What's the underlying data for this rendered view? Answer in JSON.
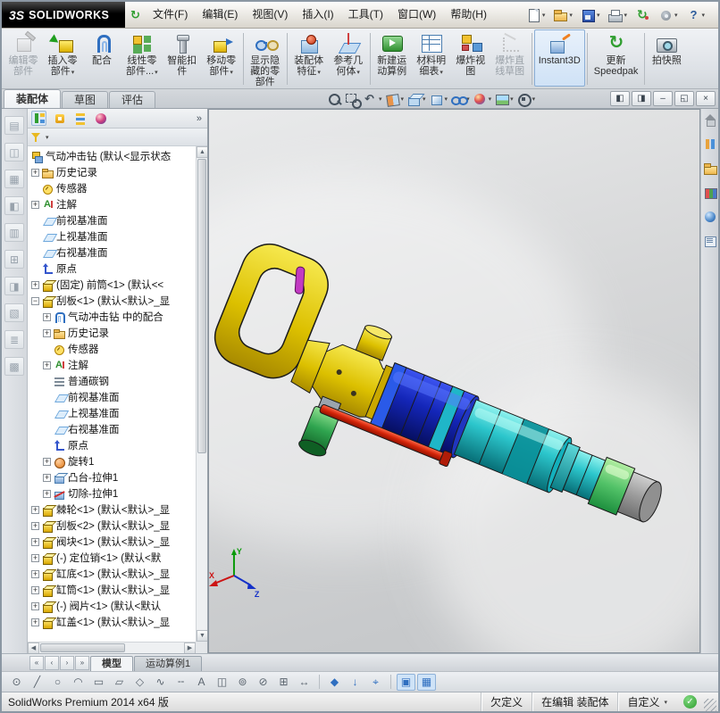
{
  "titlebar": {
    "logo_mark": "3S",
    "logo_text": "SOLIDWORKS",
    "menu": [
      {
        "name": "menu-file",
        "label": "文件(F)"
      },
      {
        "name": "menu-edit",
        "label": "编辑(E)"
      },
      {
        "name": "menu-view",
        "label": "视图(V)"
      },
      {
        "name": "menu-insert",
        "label": "插入(I)"
      },
      {
        "name": "menu-tools",
        "label": "工具(T)"
      },
      {
        "name": "menu-window",
        "label": "窗口(W)"
      },
      {
        "name": "menu-help",
        "label": "帮助(H)"
      }
    ],
    "quick_icons": [
      {
        "name": "new-document-icon",
        "caret": true
      },
      {
        "name": "open-icon",
        "caret": true
      },
      {
        "name": "save-icon",
        "caret": true
      },
      {
        "name": "print-icon",
        "caret": true
      },
      {
        "name": "rebuild-icon",
        "caret": false
      },
      {
        "name": "options-icon",
        "caret": true
      },
      {
        "name": "help-icon",
        "caret": true
      }
    ]
  },
  "ribbon": {
    "buttons": [
      {
        "name": "edit-component-button",
        "icon": "edit-component-icon",
        "lines": [
          "编辑零",
          "部件"
        ],
        "disabled": true
      },
      {
        "name": "insert-components-button",
        "icon": "insert-component-icon",
        "lines": [
          "插入零",
          "部件"
        ],
        "caret": true
      },
      {
        "name": "mate-button",
        "icon": "mate-icon",
        "lines": [
          "配合"
        ]
      },
      {
        "name": "linear-component-pattern-button",
        "icon": "linear-pattern-icon",
        "lines": [
          "线性零",
          "部件..."
        ],
        "caret": true
      },
      {
        "name": "smart-fasteners-button",
        "icon": "smart-fasteners-icon",
        "lines": [
          "智能扣",
          "件"
        ]
      },
      {
        "name": "move-component-button",
        "icon": "move-component-icon",
        "lines": [
          "移动零",
          "部件"
        ],
        "caret": true,
        "sep_after": true
      },
      {
        "name": "show-hidden-components-button",
        "icon": "show-hidden-icon",
        "lines": [
          "显示隐",
          "藏的零",
          "部件"
        ],
        "sep_after": true
      },
      {
        "name": "assembly-features-button",
        "icon": "assembly-features-icon",
        "lines": [
          "装配体",
          "特征"
        ],
        "caret": true
      },
      {
        "name": "reference-geometry-button",
        "icon": "reference-geometry-icon",
        "lines": [
          "参考几",
          "何体"
        ],
        "caret": true,
        "sep_after": true
      },
      {
        "name": "new-motion-study-button",
        "icon": "motion-study-icon",
        "lines": [
          "新建运",
          "动算例"
        ]
      },
      {
        "name": "bill-of-materials-button",
        "icon": "bom-icon",
        "lines": [
          "材料明",
          "细表"
        ],
        "caret": true
      },
      {
        "name": "exploded-view-button",
        "icon": "exploded-view-icon",
        "lines": [
          "爆炸视",
          "图"
        ]
      },
      {
        "name": "explode-line-sketch-button",
        "icon": "explode-sketch-icon",
        "lines": [
          "爆炸直",
          "线草图"
        ],
        "disabled": true,
        "sep_after": true
      },
      {
        "name": "instant3d-button",
        "icon": "instant3d-icon",
        "lines": [
          "Instant3D"
        ],
        "active": true,
        "sep_after": true
      },
      {
        "name": "update-speedpak-button",
        "icon": "speedpak-icon",
        "lines": [
          "更新",
          "Speedpak"
        ],
        "sep_after": true
      },
      {
        "name": "take-snapshot-button",
        "icon": "snapshot-icon",
        "lines": [
          "拍快照"
        ]
      }
    ]
  },
  "command_tabs": [
    {
      "name": "tab-assembly",
      "label": "装配体",
      "active": true
    },
    {
      "name": "tab-sketch",
      "label": "草图",
      "active": false
    },
    {
      "name": "tab-evaluate",
      "label": "评估",
      "active": false
    }
  ],
  "headsup": {
    "icons": [
      {
        "name": "zoom-fit-icon",
        "caret": false
      },
      {
        "name": "zoom-area-icon",
        "caret": false
      },
      {
        "name": "previous-view-icon",
        "caret": true
      },
      {
        "name": "section-view-icon",
        "caret": true
      },
      {
        "name": "view-orientation-icon",
        "caret": true
      },
      {
        "name": "display-style-icon",
        "caret": true
      },
      {
        "name": "hide-show-items-icon",
        "caret": true
      },
      {
        "name": "edit-appearance-icon",
        "caret": true
      },
      {
        "name": "apply-scene-icon",
        "caret": true
      },
      {
        "name": "view-settings-icon",
        "caret": true
      }
    ]
  },
  "doc_controls": [
    {
      "name": "pane-left-icon",
      "g": "◧"
    },
    {
      "name": "pane-right-icon",
      "g": "◨"
    },
    {
      "name": "minimize-window-icon",
      "g": "–"
    },
    {
      "name": "restore-window-icon",
      "g": "◱"
    },
    {
      "name": "close-window-icon",
      "g": "×"
    }
  ],
  "left_toolbar": {
    "items": [
      {
        "name": "docked-tool-1-icon",
        "g": "▤"
      },
      {
        "name": "docked-tool-2-icon",
        "g": "◫"
      },
      {
        "name": "docked-tool-3-icon",
        "g": "▦"
      },
      {
        "name": "docked-tool-4-icon",
        "g": "◧"
      },
      {
        "name": "docked-tool-5-icon",
        "g": "▥"
      },
      {
        "name": "docked-tool-6-icon",
        "g": "⊞"
      },
      {
        "name": "docked-tool-7-icon",
        "g": "◨"
      },
      {
        "name": "docked-tool-8-icon",
        "g": "▧"
      },
      {
        "name": "docked-tool-9-icon",
        "g": "≣"
      },
      {
        "name": "docked-tool-10-icon",
        "g": "▩"
      }
    ]
  },
  "tree_header": {
    "overflow": "»",
    "tabs": [
      {
        "name": "featuremanager-tab",
        "active": true
      },
      {
        "name": "propertymanager-tab",
        "active": false
      },
      {
        "name": "configurationmanager-tab",
        "active": false
      },
      {
        "name": "displaymanager-tab",
        "active": false
      }
    ]
  },
  "tree": {
    "items": [
      {
        "lvl": 0,
        "exp": null,
        "icon": "asm-icon",
        "label": "气动冲击钻 (默认<显示状态"
      },
      {
        "lvl": 1,
        "exp": "+",
        "icon": "history-icon",
        "label": "历史记录"
      },
      {
        "lvl": 1,
        "exp": null,
        "icon": "sensor-icon",
        "label": "传感器"
      },
      {
        "lvl": 1,
        "exp": "+",
        "icon": "annotations-icon",
        "label": "注解"
      },
      {
        "lvl": 1,
        "exp": null,
        "icon": "plane-icon",
        "label": "前视基准面"
      },
      {
        "lvl": 1,
        "exp": null,
        "icon": "plane-icon",
        "label": "上视基准面"
      },
      {
        "lvl": 1,
        "exp": null,
        "icon": "plane-icon",
        "label": "右视基准面"
      },
      {
        "lvl": 1,
        "exp": null,
        "icon": "origin-icon",
        "label": "原点"
      },
      {
        "lvl": 1,
        "exp": "+",
        "icon": "part-icon",
        "label": "(固定) 前筒<1> (默认<<"
      },
      {
        "lvl": 1,
        "exp": "−",
        "icon": "part-icon",
        "label": "刮板<1> (默认<默认>_显"
      },
      {
        "lvl": 2,
        "exp": "+",
        "icon": "mates-icon",
        "label": "气动冲击钻 中的配合"
      },
      {
        "lvl": 2,
        "exp": "+",
        "icon": "history-icon",
        "label": "历史记录"
      },
      {
        "lvl": 2,
        "exp": null,
        "icon": "sensor-icon",
        "label": "传感器"
      },
      {
        "lvl": 2,
        "exp": "+",
        "icon": "annotations-icon",
        "label": "注解"
      },
      {
        "lvl": 2,
        "exp": null,
        "icon": "material-icon",
        "label": "普通碳钢"
      },
      {
        "lvl": 2,
        "exp": null,
        "icon": "plane-icon",
        "label": "前视基准面"
      },
      {
        "lvl": 2,
        "exp": null,
        "icon": "plane-icon",
        "label": "上视基准面"
      },
      {
        "lvl": 2,
        "exp": null,
        "icon": "plane-icon",
        "label": "右视基准面"
      },
      {
        "lvl": 2,
        "exp": null,
        "icon": "origin-icon",
        "label": "原点"
      },
      {
        "lvl": 2,
        "exp": "+",
        "icon": "revolve-icon",
        "label": "旋转1"
      },
      {
        "lvl": 2,
        "exp": "+",
        "icon": "extrude-icon",
        "label": "凸台-拉伸1"
      },
      {
        "lvl": 2,
        "exp": "+",
        "icon": "cut-icon",
        "label": "切除-拉伸1"
      },
      {
        "lvl": 1,
        "exp": "+",
        "icon": "part-icon",
        "label": "棘轮<1> (默认<默认>_显"
      },
      {
        "lvl": 1,
        "exp": "+",
        "icon": "part-icon",
        "label": "刮板<2> (默认<默认>_显"
      },
      {
        "lvl": 1,
        "exp": "+",
        "icon": "part-icon",
        "label": "阀块<1> (默认<默认>_显"
      },
      {
        "lvl": 1,
        "exp": "+",
        "icon": "part-icon",
        "label": "(-) 定位销<1> (默认<默"
      },
      {
        "lvl": 1,
        "exp": "+",
        "icon": "part-icon",
        "label": "缸底<1> (默认<默认>_显"
      },
      {
        "lvl": 1,
        "exp": "+",
        "icon": "part-icon",
        "label": "缸筒<1> (默认<默认>_显"
      },
      {
        "lvl": 1,
        "exp": "+",
        "icon": "part-icon",
        "label": "(-) 阀片<1> (默认<默认"
      },
      {
        "lvl": 1,
        "exp": "+",
        "icon": "part-icon",
        "label": "缸盖<1> (默认<默认>_显"
      }
    ]
  },
  "task_pane": {
    "items": [
      {
        "name": "solidworks-resources-tab"
      },
      {
        "name": "design-library-tab"
      },
      {
        "name": "file-explorer-tab"
      },
      {
        "name": "view-palette-tab"
      },
      {
        "name": "appearances-tab"
      },
      {
        "name": "custom-properties-tab"
      }
    ]
  },
  "viewport": {
    "triad": {
      "x": "X",
      "y": "Y",
      "z": "Z"
    }
  },
  "model_tabs": {
    "nav": [
      {
        "name": "first-tab-icon",
        "g": "«"
      },
      {
        "name": "prev-tab-icon",
        "g": "‹"
      },
      {
        "name": "next-tab-icon",
        "g": "›"
      },
      {
        "name": "last-tab-icon",
        "g": "»"
      }
    ],
    "tabs": [
      {
        "name": "model-tab",
        "label": "模型",
        "active": true
      },
      {
        "name": "motion-study-tab",
        "label": "运动算例1",
        "active": false
      }
    ]
  },
  "bottom_toolbar": {
    "items": [
      {
        "name": "sketch-circle-tool",
        "g": "⊙"
      },
      {
        "name": "sketch-line-tool",
        "g": "╱"
      },
      {
        "name": "sketch-ellipse-tool",
        "g": "○"
      },
      {
        "name": "sketch-arc-tool",
        "g": "◠"
      },
      {
        "name": "sketch-rectangle-tool",
        "g": "▭"
      },
      {
        "name": "sketch-parallelogram-tool",
        "g": "▱"
      },
      {
        "name": "sketch-polygon-tool",
        "g": "◇"
      },
      {
        "name": "sketch-spline-tool",
        "g": "∿"
      },
      {
        "name": "sketch-centerline-tool",
        "g": "╌"
      },
      {
        "name": "sketch-text-tool",
        "g": "A"
      },
      {
        "name": "sketch-mirror-tool",
        "g": "◫"
      },
      {
        "name": "sketch-offset-tool",
        "g": "⊚"
      },
      {
        "name": "sketch-trim-tool",
        "g": "⊘"
      },
      {
        "name": "sketch-pattern-tool",
        "g": "⊞"
      },
      {
        "name": "sketch-move-tool",
        "g": "↔"
      },
      {
        "type": "sep"
      },
      {
        "name": "view-cube-tool",
        "g": "◆",
        "blue": true
      },
      {
        "name": "drop-down-tool",
        "g": "↓",
        "blue": true
      },
      {
        "name": "zoom-select-tool",
        "g": "⌖",
        "blue": true
      },
      {
        "type": "sep"
      },
      {
        "name": "sketch-mode-toggle",
        "g": "▣",
        "active": true
      },
      {
        "name": "rapid-sketch-toggle",
        "g": "▦",
        "active": true
      }
    ]
  },
  "status": {
    "left": "SolidWorks Premium 2014 x64 版",
    "state": "欠定义",
    "editing": "在编辑 装配体",
    "custom": "自定义"
  }
}
